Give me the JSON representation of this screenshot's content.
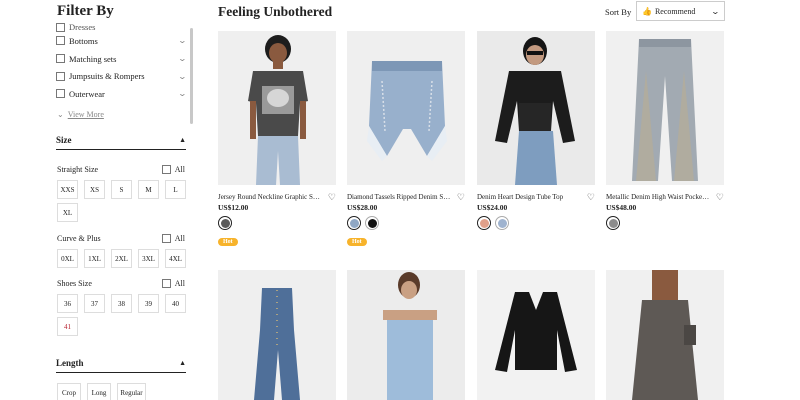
{
  "sidebar": {
    "title": "Filter By",
    "categories": [
      {
        "label": "Bottoms"
      },
      {
        "label": "Matching sets"
      },
      {
        "label": "Jumpsuits & Rompers"
      },
      {
        "label": "Outerwear"
      }
    ],
    "partial_category": "Dresses",
    "view_more": "View More",
    "size_section": "Size",
    "straight_size": {
      "label": "Straight Size",
      "all": "All",
      "sizes": [
        "XXS",
        "XS",
        "S",
        "M",
        "L",
        "XL"
      ]
    },
    "curve_plus": {
      "label": "Curve & Plus",
      "all": "All",
      "sizes": [
        "0XL",
        "1XL",
        "2XL",
        "3XL",
        "4XL"
      ]
    },
    "shoes_size": {
      "label": "Shoes Size",
      "all": "All",
      "sizes": [
        "36",
        "37",
        "38",
        "39",
        "40",
        "41"
      ]
    },
    "length_section": "Length",
    "lengths": [
      "Crop",
      "Long",
      "Regular"
    ]
  },
  "main": {
    "title": "Feeling Unbothered",
    "sort_label": "Sort By",
    "sort_value": "Recommend",
    "products": [
      {
        "name": "Jersey Round Neckline Graphic Sho...",
        "price": "US$12.00",
        "badge": "Hot",
        "swatches": [
          "#5a5a5a"
        ]
      },
      {
        "name": "Diamond Tassels Ripped Denim Sh...",
        "price": "US$28.00",
        "badge": "Hot",
        "swatches": [
          "#8fa7c4",
          "#111111"
        ]
      },
      {
        "name": "Denim Heart Design Tube Top",
        "price": "US$24.00",
        "badge": "",
        "swatches": [
          "#e0a08a",
          "#9fb3cf"
        ]
      },
      {
        "name": "Metallic Denim High Waist Pocket ...",
        "price": "US$48.00",
        "badge": "",
        "swatches": [
          "#8c8c8c"
        ]
      }
    ]
  },
  "colors": {
    "badge": "#f7b32b",
    "sale_red": "#b7202e"
  }
}
